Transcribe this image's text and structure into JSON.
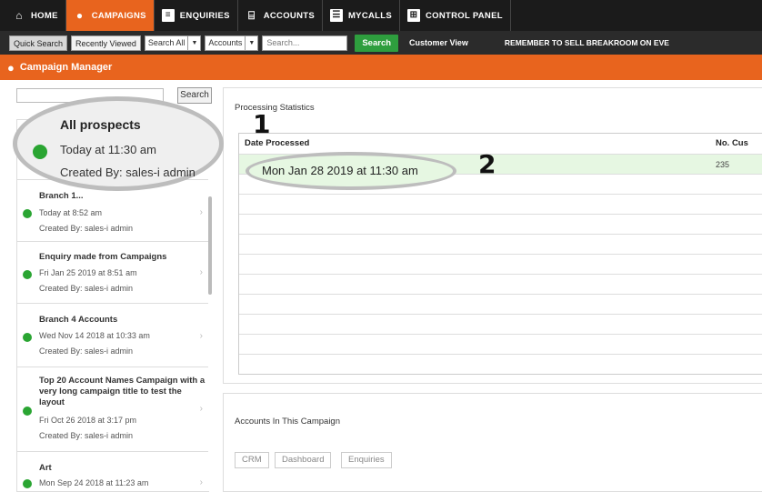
{
  "nav": {
    "items": [
      {
        "label": "HOME",
        "icon": "home-icon",
        "active": false
      },
      {
        "label": "CAMPAIGNS",
        "icon": "campaign-icon",
        "active": true
      },
      {
        "label": "ENQUIRIES",
        "icon": "enquiries-icon",
        "active": false
      },
      {
        "label": "ACCOUNTS",
        "icon": "accounts-icon",
        "active": false
      },
      {
        "label": "MYCALLS",
        "icon": "mycalls-icon",
        "active": false
      },
      {
        "label": "CONTROL PANEL",
        "icon": "control-panel-icon",
        "active": false
      }
    ]
  },
  "searchbar": {
    "quick_search": "Quick Search",
    "recently_viewed": "Recently Viewed",
    "search_all": "Search All",
    "accounts": "Accounts",
    "placeholder": "Search...",
    "search_btn": "Search",
    "customer_view": "Customer View",
    "notice": "REMEMBER TO SELL BREAKROOM ON EVE"
  },
  "titlebar": {
    "title": "Campaign Manager"
  },
  "left": {
    "search_btn": "Search",
    "items": [
      {
        "title": "All prospects",
        "date": "Today at 11:30 am",
        "by": "Created By: sales-i admin"
      },
      {
        "title": "Branch 1...",
        "date": "Today at 8:52 am",
        "by": "Created By: sales-i admin"
      },
      {
        "title": "Enquiry made from Campaigns",
        "date": "Fri Jan 25 2019 at 8:51 am",
        "by": "Created By: sales-i admin"
      },
      {
        "title": "Branch 4 Accounts",
        "date": "Wed Nov 14 2018 at 10:33 am",
        "by": "Created By: sales-i admin"
      },
      {
        "title": "Top 20 Account Names Campaign with a very long campaign title to test the layout",
        "date": "Fri Oct 26 2018 at 3:17 pm",
        "by": "Created By: sales-i admin"
      },
      {
        "title": "Art",
        "date": "Mon Sep 24 2018 at 11:23 am",
        "by": ""
      }
    ]
  },
  "callout1": {
    "number": "1",
    "title": "All prospects",
    "time": "Today at 11:30 am",
    "by": "Created By: sales-i admin"
  },
  "processing": {
    "title": "Processing Statistics",
    "col_date": "Date Processed",
    "col_count": "No. Cus",
    "row_value": "235",
    "callout_number": "2",
    "callout_text": "Mon Jan 28 2019 at 11:30 am"
  },
  "accounts_panel": {
    "title": "Accounts In This Campaign",
    "buttons": [
      "CRM",
      "Dashboard",
      "Enquiries"
    ]
  },
  "colors": {
    "accent": "#e8641e",
    "green": "#2aa532",
    "nav_bg": "#1b1b1b"
  }
}
